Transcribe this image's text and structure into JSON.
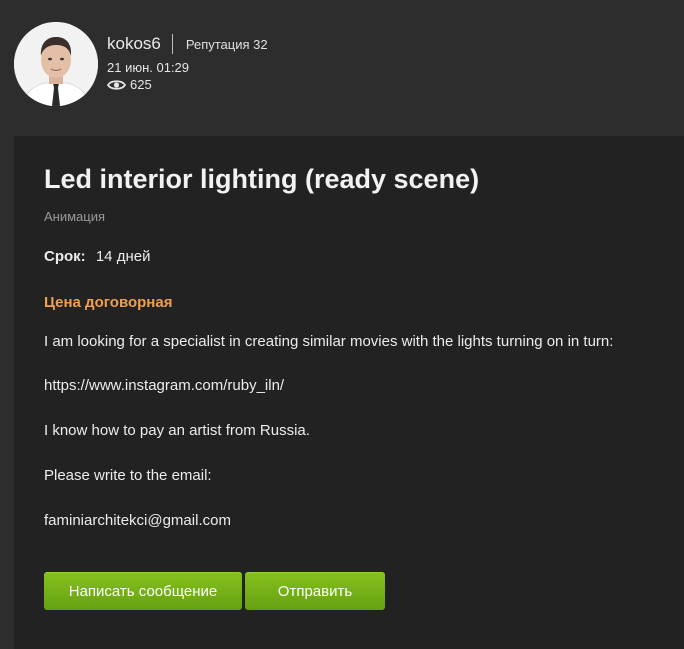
{
  "user": {
    "username": "kokos6",
    "reputation": "Репутация 32",
    "date": "21 июн. 01:29",
    "views": "625"
  },
  "task": {
    "title": "Led interior lighting (ready scene)",
    "category": "Анимация",
    "deadline_label": "Срок:",
    "deadline_value": "14 дней",
    "price": "Цена договорная",
    "description": [
      "I am looking for a specialist in creating similar movies with the lights turning on in turn:",
      "https://www.instagram.com/ruby_iln/",
      "I know how to pay an artist from Russia.",
      "Please write to the email:",
      "faminiarchitekci@gmail.com"
    ]
  },
  "actions": {
    "message_label": "Написать сообщение",
    "send_label": "Отправить"
  },
  "colors": {
    "background": "#2d2d2d",
    "card": "#222222",
    "price_accent": "#f0a04c",
    "button_green": "#76b418"
  },
  "icons": {
    "views": "eye-icon"
  }
}
